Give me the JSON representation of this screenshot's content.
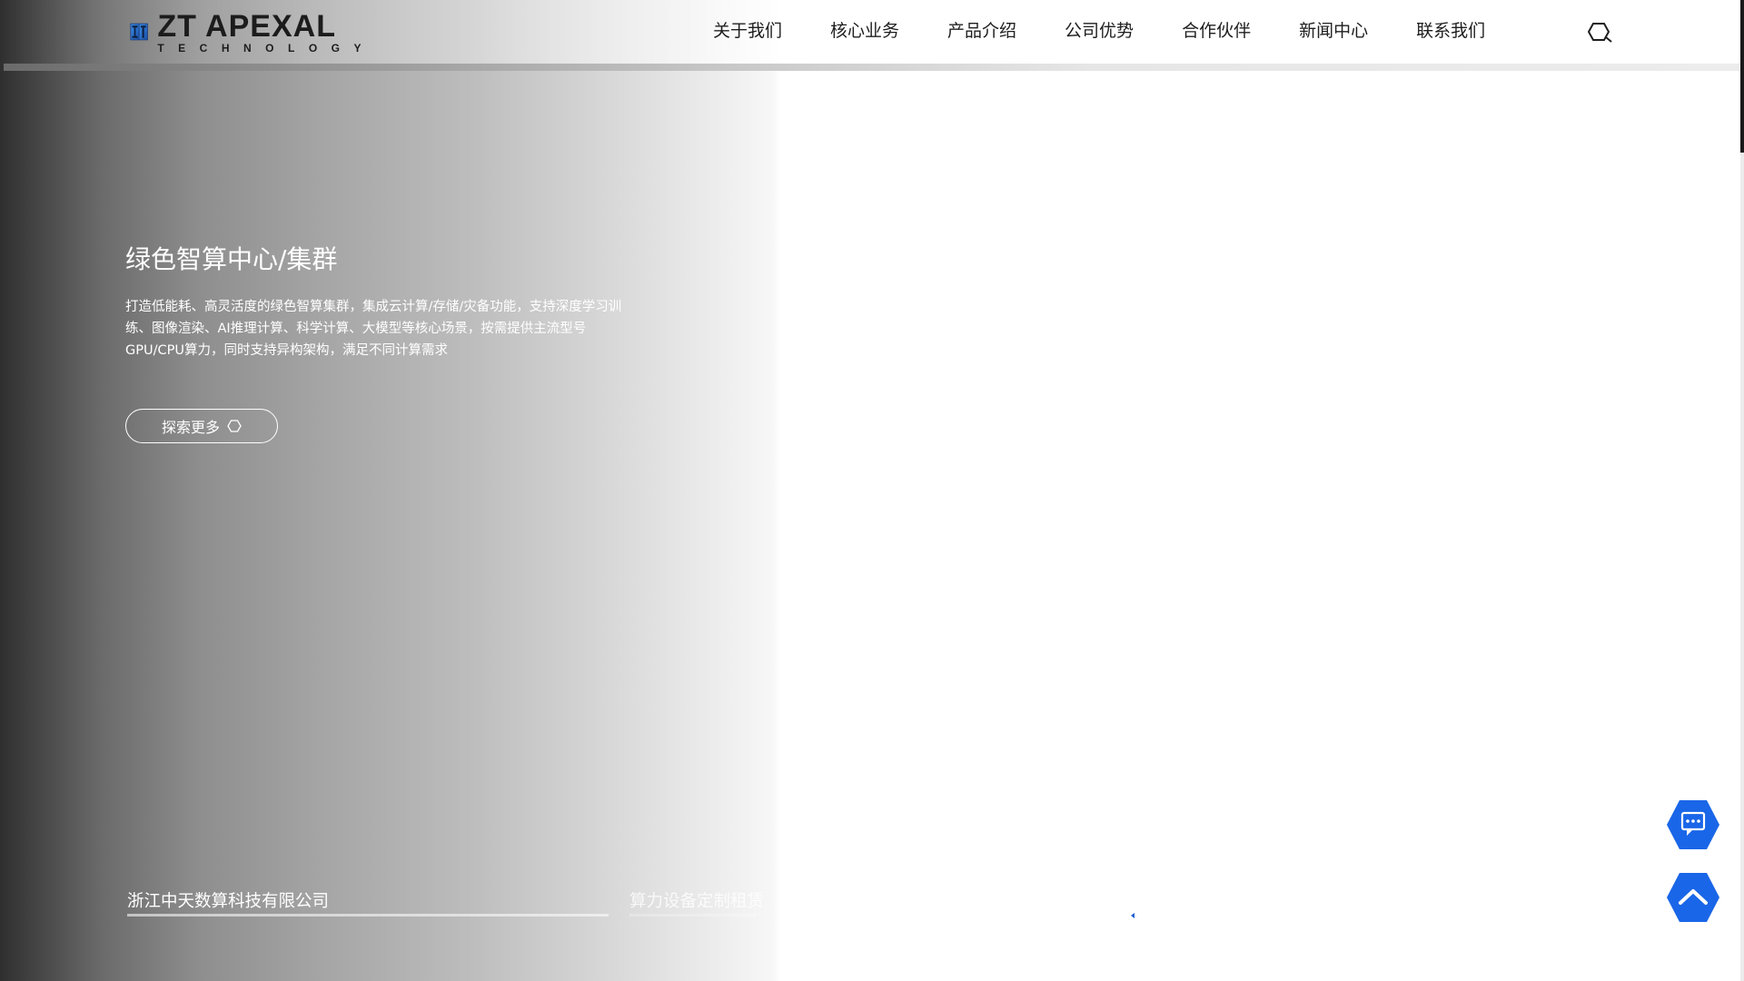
{
  "header": {
    "logo": {
      "name": "ZT APEXAL",
      "subtitle": "TECHNOLOGY"
    },
    "nav": [
      {
        "label": "关于我们"
      },
      {
        "label": "核心业务"
      },
      {
        "label": "产品介绍"
      },
      {
        "label": "公司优势"
      },
      {
        "label": "合作伙伴"
      },
      {
        "label": "新闻中心"
      },
      {
        "label": "联系我们"
      }
    ],
    "search_icon": "search-icon"
  },
  "hero": {
    "title": "绿色智算中心/集群",
    "description": "打造低能耗、高灵活度的绿色智算集群，集成云计算/存储/灾备功能，支持深度学习训练、图像渲染、AI推理计算、科学计算、大模型等核心场景，按需提供主流型号GPU/CPU算力，同时支持异构架构，满足不同计算需求",
    "button_label": "探索更多"
  },
  "tabs": [
    {
      "label": "浙江中天数算科技有限公司",
      "active": true,
      "progress": 1.0
    },
    {
      "label": "算力设备定制租赁",
      "active": false,
      "progress": 0
    }
  ],
  "floating": {
    "chat_icon": "chat-icon",
    "back_to_top_icon": "chevron-up-icon"
  },
  "colors": {
    "accent": "#1a66e8",
    "text_dark": "#1e1e1e",
    "text_light": "#ffffff"
  }
}
